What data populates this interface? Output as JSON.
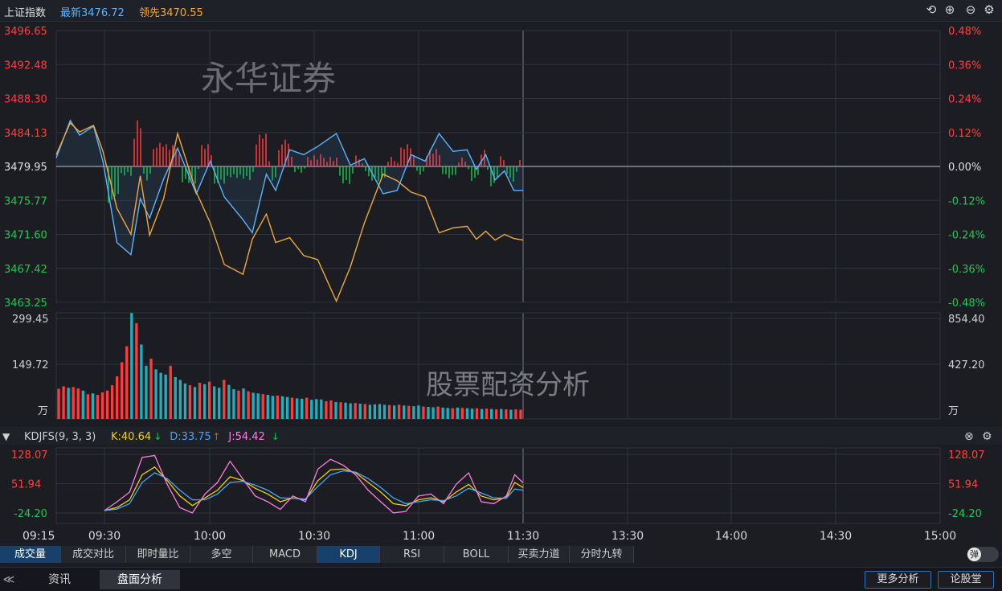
{
  "header": {
    "index_name": "上证指数",
    "latest_label": "最新3476.72",
    "leading_label": "领先3470.55",
    "icons": [
      "undo-icon",
      "zoom-in-icon",
      "zoom-out-icon",
      "settings-icon"
    ]
  },
  "chart_data": [
    {
      "type": "line",
      "name": "intraday-price",
      "prev_close": 3479.95,
      "ylim": [
        3463.25,
        3496.65
      ],
      "y_ticks_left": [
        "3496.65",
        "3492.48",
        "3488.30",
        "3484.13",
        "3479.95",
        "3475.77",
        "3471.60",
        "3467.42",
        "3463.25"
      ],
      "y_ticks_right": [
        "0.48%",
        "0.36%",
        "0.24%",
        "0.12%",
        "0.00%",
        "-0.12%",
        "-0.24%",
        "-0.36%",
        "-0.48%"
      ],
      "x_ticks": [
        "09:15",
        "09:30",
        "10:00",
        "10:30",
        "11:00",
        "11:30",
        "13:30",
        "14:00",
        "14:30",
        "15:00"
      ],
      "watermark": "永华证券",
      "series": [
        {
          "color": "#5ab4ff",
          "x": [
            0,
            0.03,
            0.05,
            0.08,
            0.1,
            0.13,
            0.16,
            0.18,
            0.2,
            0.23,
            0.26,
            0.3,
            0.33,
            0.36,
            0.4,
            0.42,
            0.45,
            0.47,
            0.5,
            0.53,
            0.56,
            0.6,
            0.63,
            0.66,
            0.7,
            0.73,
            0.76,
            0.79,
            0.82,
            0.85,
            0.88,
            0.9,
            0.92,
            0.94,
            0.96,
            0.98,
            1.0
          ],
          "y": [
            3481.0,
            3485.6,
            3483.8,
            3484.9,
            3480.6,
            3470.6,
            3469.1,
            3476.0,
            3473.6,
            3478.4,
            3482.2,
            3476.6,
            3480.6,
            3476.2,
            3473.4,
            3471.8,
            3479.0,
            3477.0,
            3482.0,
            3481.4,
            3482.4,
            3484.0,
            3480.1,
            3480.9,
            3476.6,
            3477.0,
            3481.4,
            3480.6,
            3484.0,
            3481.8,
            3482.0,
            3479.6,
            3481.4,
            3478.3,
            3479.4,
            3477.0,
            3477.0
          ]
        },
        {
          "color": "#f0a840",
          "x": [
            0,
            0.03,
            0.05,
            0.08,
            0.1,
            0.13,
            0.16,
            0.18,
            0.2,
            0.23,
            0.26,
            0.3,
            0.33,
            0.36,
            0.4,
            0.42,
            0.45,
            0.47,
            0.5,
            0.53,
            0.56,
            0.6,
            0.63,
            0.66,
            0.7,
            0.73,
            0.76,
            0.79,
            0.82,
            0.85,
            0.88,
            0.9,
            0.92,
            0.94,
            0.96,
            0.98,
            1.0
          ],
          "y": [
            3481.4,
            3485.3,
            3484.2,
            3485.0,
            3481.8,
            3474.8,
            3471.6,
            3478.8,
            3471.5,
            3476.0,
            3484.0,
            3476.8,
            3473.0,
            3467.9,
            3466.7,
            3471.0,
            3474.1,
            3470.6,
            3471.2,
            3469.0,
            3468.5,
            3463.4,
            3467.6,
            3473.0,
            3479.0,
            3478.2,
            3476.8,
            3476.2,
            3471.8,
            3472.4,
            3472.6,
            3471.0,
            3472.0,
            3470.9,
            3471.6,
            3471.1,
            3470.9
          ]
        }
      ]
    },
    {
      "type": "bar",
      "name": "volume",
      "y_ticks_left": [
        "299.45",
        "149.72",
        "万"
      ],
      "y_ticks_right": [
        "854.40",
        "427.20",
        "万"
      ],
      "ylim": [
        0,
        299.45
      ],
      "watermark": "股票配资分析",
      "values": [
        85,
        92,
        88,
        90,
        86,
        80,
        70,
        72,
        68,
        75,
        80,
        95,
        120,
        160,
        205,
        299,
        270,
        210,
        150,
        170,
        140,
        130,
        125,
        150,
        118,
        110,
        100,
        95,
        90,
        102,
        98,
        105,
        92,
        88,
        110,
        96,
        84,
        80,
        86,
        78,
        74,
        72,
        70,
        68,
        65,
        66,
        64,
        62,
        60,
        58,
        57,
        60,
        54,
        56,
        55,
        50,
        52,
        48,
        47,
        46,
        44,
        45,
        43,
        42,
        40,
        41,
        42,
        40,
        39,
        38,
        40,
        38,
        37,
        36,
        38,
        35,
        34,
        33,
        35,
        32,
        31,
        30,
        32,
        31,
        30,
        29,
        30,
        28,
        29,
        28,
        27,
        28,
        27,
        26,
        27,
        26
      ],
      "colors": [
        "up",
        "up",
        "flat",
        "up",
        "up",
        "flat",
        "up",
        "flat",
        "up",
        "up",
        "up",
        "up",
        "up",
        "up",
        "up",
        "flat",
        "up",
        "flat",
        "flat",
        "up",
        "flat",
        "flat",
        "flat",
        "up",
        "flat",
        "flat",
        "flat",
        "up",
        "flat",
        "up",
        "flat",
        "up",
        "flat",
        "flat",
        "up",
        "flat",
        "flat",
        "up",
        "flat",
        "up",
        "flat",
        "flat",
        "up",
        "flat",
        "flat",
        "up",
        "flat",
        "flat",
        "up",
        "flat",
        "flat",
        "up",
        "flat",
        "flat",
        "flat",
        "up",
        "up",
        "flat",
        "up",
        "flat",
        "flat",
        "up",
        "flat",
        "up",
        "flat",
        "flat",
        "flat",
        "flat",
        "up",
        "flat",
        "up",
        "flat",
        "up",
        "flat",
        "flat",
        "up",
        "flat",
        "flat",
        "up",
        "flat",
        "flat",
        "up",
        "flat",
        "up",
        "flat",
        "flat",
        "up",
        "flat",
        "up",
        "flat",
        "up",
        "flat",
        "up",
        "flat",
        "up",
        "up"
      ]
    },
    {
      "type": "line",
      "name": "kdj",
      "title": "KDJFS(9, 3, 3)",
      "ylim": [
        -24.2,
        128.07
      ],
      "y_ticks": [
        "128.07",
        "51.94",
        "-24.20"
      ],
      "legend": [
        {
          "label": "K:40.64",
          "arrow": "down",
          "color": "#f5d000"
        },
        {
          "label": "D:33.75",
          "arrow": "up",
          "color": "#3fa8ff"
        },
        {
          "label": "J:54.42",
          "arrow": "down",
          "color": "#ff7de0"
        }
      ],
      "series": [
        {
          "color": "#f5d000",
          "x": [
            0,
            0.03,
            0.06,
            0.09,
            0.12,
            0.15,
            0.18,
            0.21,
            0.24,
            0.27,
            0.3,
            0.33,
            0.36,
            0.39,
            0.42,
            0.45,
            0.48,
            0.51,
            0.54,
            0.57,
            0.6,
            0.63,
            0.66,
            0.69,
            0.72,
            0.75,
            0.78,
            0.81,
            0.84,
            0.87,
            0.9,
            0.93,
            0.96,
            0.98,
            1.0
          ],
          "y": [
            -18,
            -10,
            10,
            75,
            95,
            60,
            20,
            -5,
            15,
            35,
            70,
            60,
            40,
            25,
            5,
            15,
            10,
            60,
            88,
            90,
            80,
            55,
            30,
            0,
            -5,
            10,
            15,
            5,
            30,
            50,
            20,
            10,
            15,
            55,
            42
          ]
        },
        {
          "color": "#3fa8ff",
          "x": [
            0,
            0.03,
            0.06,
            0.09,
            0.12,
            0.15,
            0.18,
            0.21,
            0.24,
            0.27,
            0.3,
            0.33,
            0.36,
            0.39,
            0.42,
            0.45,
            0.48,
            0.51,
            0.54,
            0.57,
            0.6,
            0.63,
            0.66,
            0.69,
            0.72,
            0.75,
            0.78,
            0.81,
            0.84,
            0.87,
            0.9,
            0.93,
            0.96,
            0.98,
            1.0
          ],
          "y": [
            -18,
            -14,
            0,
            55,
            80,
            65,
            35,
            10,
            10,
            25,
            55,
            58,
            48,
            35,
            15,
            14,
            12,
            45,
            75,
            85,
            82,
            65,
            42,
            15,
            0,
            5,
            10,
            8,
            20,
            40,
            28,
            15,
            14,
            38,
            35
          ]
        },
        {
          "color": "#ff7de0",
          "x": [
            0,
            0.03,
            0.06,
            0.09,
            0.12,
            0.15,
            0.18,
            0.21,
            0.24,
            0.27,
            0.3,
            0.33,
            0.36,
            0.39,
            0.42,
            0.45,
            0.48,
            0.51,
            0.54,
            0.57,
            0.6,
            0.63,
            0.66,
            0.69,
            0.72,
            0.75,
            0.78,
            0.81,
            0.84,
            0.87,
            0.9,
            0.93,
            0.96,
            0.98,
            1.0
          ],
          "y": [
            -18,
            5,
            30,
            120,
            125,
            50,
            -10,
            -24,
            25,
            55,
            110,
            65,
            20,
            5,
            -15,
            20,
            5,
            90,
            115,
            100,
            75,
            35,
            5,
            -24,
            -20,
            20,
            25,
            0,
            50,
            80,
            5,
            0,
            20,
            75,
            54
          ]
        }
      ]
    }
  ],
  "indicator_tabs": [
    {
      "label": "成交量",
      "active": true
    },
    {
      "label": "成交对比",
      "active": false
    },
    {
      "label": "即时量比",
      "active": false
    },
    {
      "label": "多空",
      "active": false
    },
    {
      "label": "MACD",
      "active": false
    },
    {
      "label": "KDJ",
      "active": true
    },
    {
      "label": "RSI",
      "active": false
    },
    {
      "label": "BOLL",
      "active": false
    },
    {
      "label": "买卖力道",
      "active": false
    },
    {
      "label": "分时九转",
      "active": false
    }
  ],
  "popup_toggle": "弹",
  "footer": {
    "tabs": [
      {
        "label": "资讯",
        "active": false
      },
      {
        "label": "盘面分析",
        "active": true
      }
    ],
    "buttons": [
      "更多分析",
      "论股堂"
    ]
  },
  "colors": {
    "up": "#ff3b3b",
    "down": "#17c24a",
    "flat": "#1fb0c0",
    "grid": "#30333c",
    "bg": "#1b1d23"
  }
}
